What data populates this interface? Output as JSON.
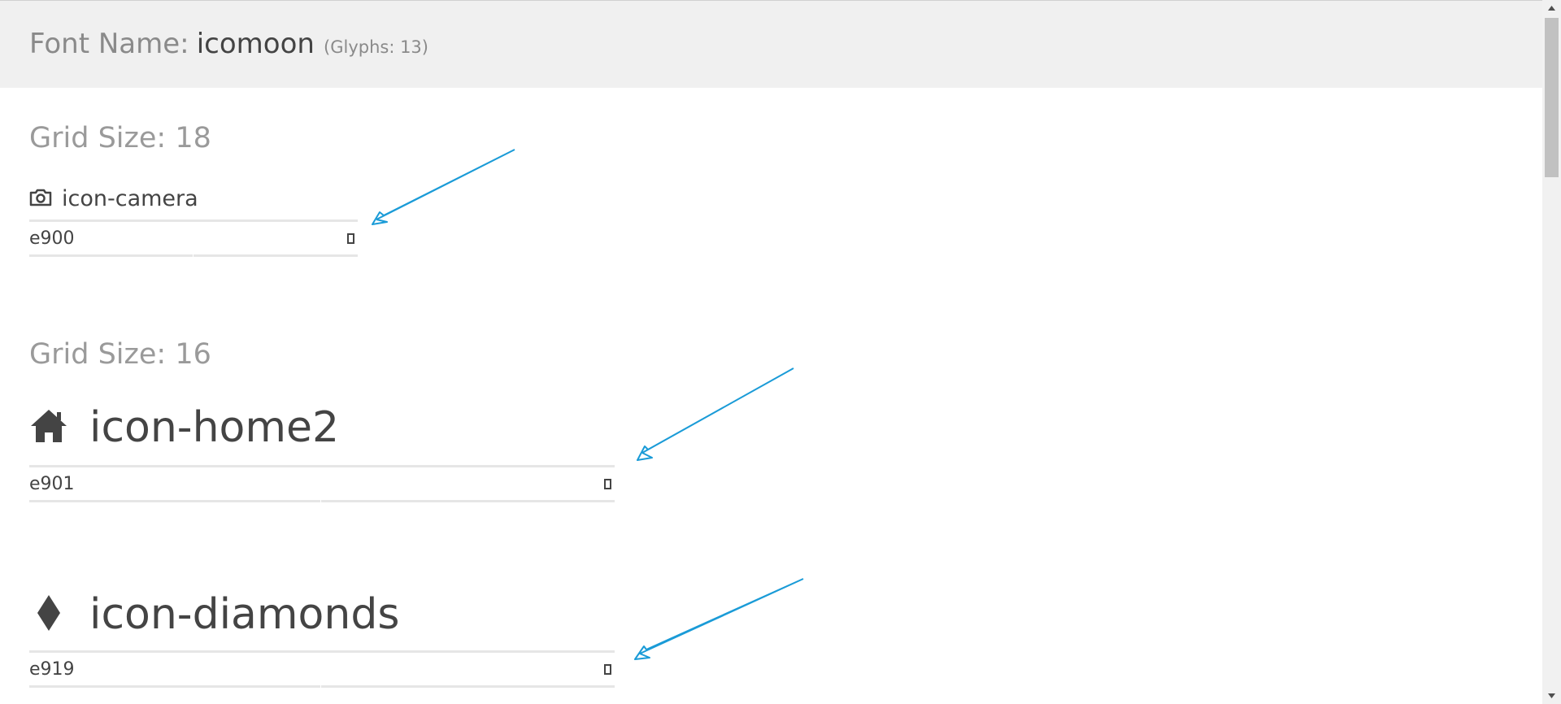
{
  "header": {
    "label": "Font Name:",
    "font_name": "icomoon",
    "glyph_count": "(Glyphs: 13)"
  },
  "groups": [
    {
      "heading": "Grid Size: 18",
      "glyphs": [
        {
          "icon": "camera-icon",
          "name": "icon-camera",
          "code": "e900"
        }
      ]
    },
    {
      "heading": "Grid Size: 16",
      "glyphs": [
        {
          "icon": "home-icon",
          "name": "icon-home2",
          "code": "e901"
        },
        {
          "icon": "diamond-icon",
          "name": "icon-diamonds",
          "code": "e919"
        }
      ]
    }
  ],
  "colors": {
    "header_bg": "#f0f0f0",
    "arrow": "#1a9bd7",
    "text": "#444444",
    "muted": "#9a9a9a"
  }
}
